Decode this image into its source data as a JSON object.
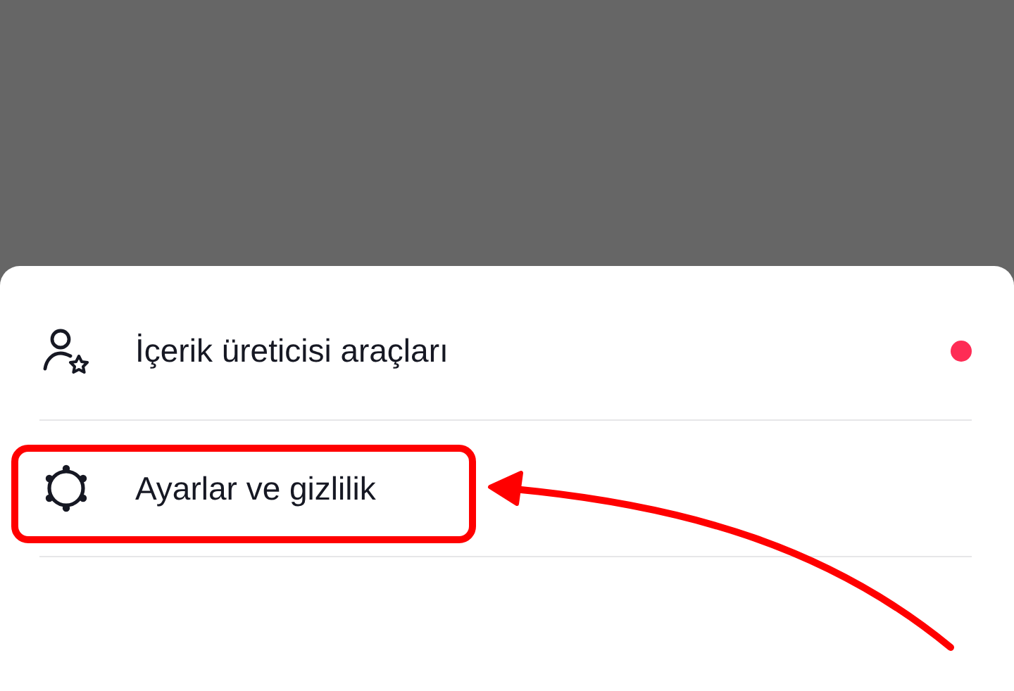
{
  "menu": {
    "items": [
      {
        "label": "İçerik üreticisi araçları",
        "kind": "creator",
        "notification": true,
        "highlighted": false
      },
      {
        "label": "Ayarlar ve gizlilik",
        "kind": "settings",
        "notification": false,
        "highlighted": true
      }
    ]
  }
}
